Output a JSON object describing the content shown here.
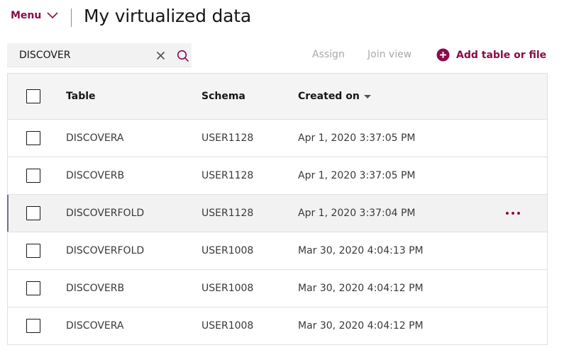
{
  "header": {
    "menu_label": "Menu",
    "title": "My virtualized data"
  },
  "toolbar": {
    "search_value": "DISCOVER",
    "assign_label": "Assign",
    "join_view_label": "Join view",
    "add_label": "Add table or file"
  },
  "colors": {
    "accent": "#8a0b4b",
    "disabled_text": "#a8a8a8",
    "header_bg": "#f4f4f4",
    "row_hover_bg": "#f2f2f2"
  },
  "icons": {
    "menu": "chevron-down-icon",
    "clear": "close-icon",
    "search": "search-icon",
    "add": "add-circle-icon",
    "row_menu": "overflow-menu-icon"
  },
  "table": {
    "columns": {
      "table": "Table",
      "schema": "Schema",
      "created_on": "Created on"
    },
    "sort": {
      "column": "created_on",
      "direction": "descending"
    },
    "rows": [
      {
        "table": "DISCOVERA",
        "schema": "USER1128",
        "created_on": "Apr 1, 2020 3:37:05 PM"
      },
      {
        "table": "DISCOVERB",
        "schema": "USER1128",
        "created_on": "Apr 1, 2020 3:37:05 PM"
      },
      {
        "table": "DISCOVERFOLD",
        "schema": "USER1128",
        "created_on": "Apr 1, 2020 3:37:04 PM"
      },
      {
        "table": "DISCOVERFOLD",
        "schema": "USER1008",
        "created_on": "Mar 30, 2020 4:04:13 PM"
      },
      {
        "table": "DISCOVERB",
        "schema": "USER1008",
        "created_on": "Mar 30, 2020 4:04:12 PM"
      },
      {
        "table": "DISCOVERA",
        "schema": "USER1008",
        "created_on": "Mar 30, 2020 4:04:12 PM"
      }
    ]
  }
}
